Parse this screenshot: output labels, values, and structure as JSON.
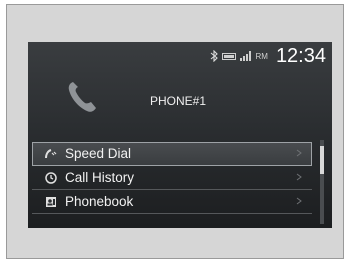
{
  "status": {
    "bluetooth_icon": "bluetooth-icon",
    "battery_icon": "battery-icon",
    "signal_icon": "signal-icon",
    "carrier": "RM",
    "time": "12:34"
  },
  "phone": {
    "icon": "phone-handset-icon",
    "name": "PHONE#1"
  },
  "menu": {
    "items": [
      {
        "label": "Speed Dial",
        "icon": "speed-dial-icon",
        "selected": true
      },
      {
        "label": "Call History",
        "icon": "history-icon",
        "selected": false
      },
      {
        "label": "Phonebook",
        "icon": "phonebook-icon",
        "selected": false
      }
    ]
  }
}
